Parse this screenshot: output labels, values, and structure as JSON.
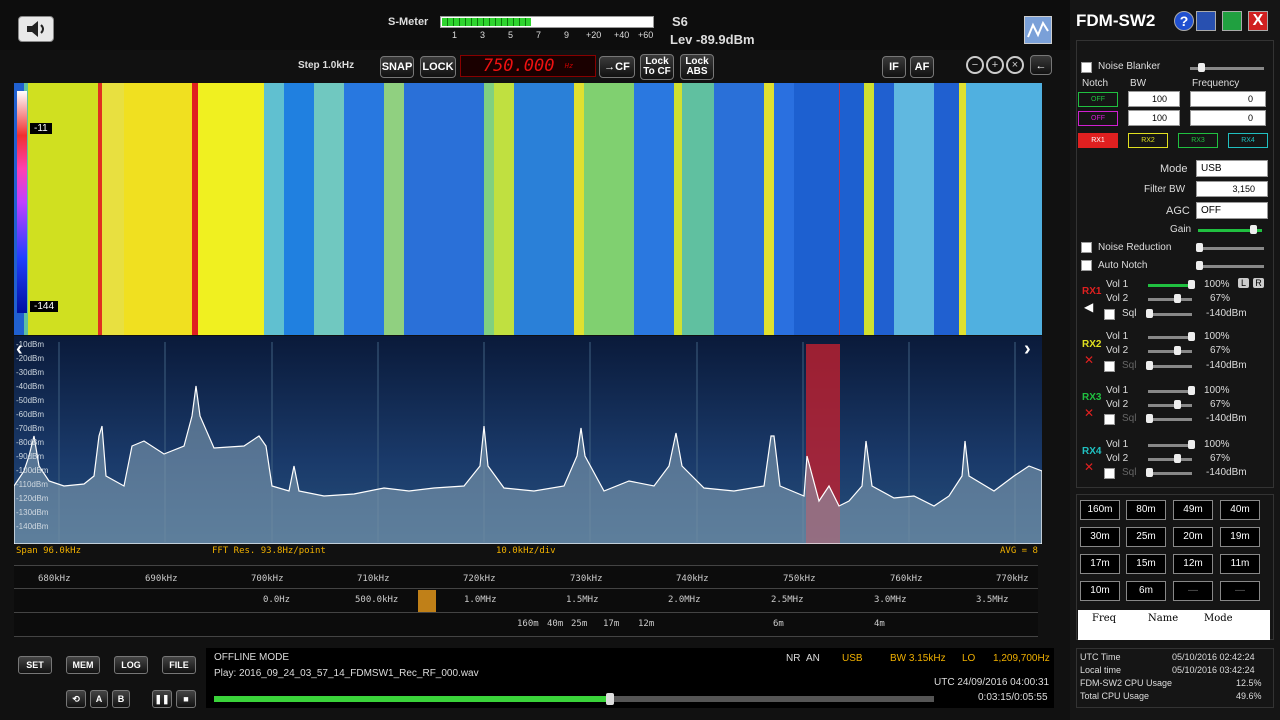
{
  "app": {
    "title": "FDM-SW2",
    "help": "?"
  },
  "smeter": {
    "label": "S-Meter",
    "ticks": [
      "1",
      "3",
      "5",
      "7",
      "9",
      "+20",
      "+40",
      "+60"
    ],
    "s_value": "S6",
    "level": "Lev -89.9dBm",
    "fill_fraction": 0.42
  },
  "controls": {
    "step": "Step 1.0kHz",
    "snap": "SNAP",
    "lock": "LOCK",
    "frequency": "750.000",
    "freq_unit": "Hz",
    "to_cf": "→CF",
    "lock_to_cf_1": "Lock",
    "lock_to_cf_2": "To CF",
    "lock_abs_1": "Lock",
    "lock_abs_2": "ABS",
    "if": "IF",
    "af": "AF"
  },
  "waterfall": {
    "top_label": "-11",
    "bottom_label": "-144"
  },
  "spectrum": {
    "db_labels": [
      "-10dBm",
      "-20dBm",
      "-30dBm",
      "-40dBm",
      "-50dBm",
      "-60dBm",
      "-70dBm",
      "-80dBm",
      "-90dBm",
      "-100dBm",
      "-110dBm",
      "-120dBm",
      "-130dBm",
      "-140dBm"
    ],
    "span": "Span 96.0kHz",
    "fft": "FFT Res. 93.8Hz/point",
    "div": "10.0kHz/div",
    "avg": "AVG = 8"
  },
  "freqscale": {
    "row1": [
      "680kHz",
      "690kHz",
      "700kHz",
      "710kHz",
      "720kHz",
      "730kHz",
      "740kHz",
      "750kHz",
      "760kHz",
      "770kHz"
    ],
    "row2": [
      "0.0Hz",
      "500.0kHz",
      "1.0MHz",
      "1.5MHz",
      "2.0MHz",
      "2.5MHz",
      "3.0MHz",
      "3.5MHz"
    ],
    "row3": [
      "160m",
      "40m",
      "25m",
      "17m",
      "12m",
      "6m",
      "4m"
    ]
  },
  "bottom_buttons": {
    "set": "SET",
    "mem": "MEM",
    "log": "LOG",
    "file": "FILE",
    "a": "A",
    "b": "B"
  },
  "status": {
    "mode": "OFFLINE MODE",
    "play": "Play: 2016_09_24_03_57_14_FDMSW1_Rec_RF_000.wav",
    "nr": "NR",
    "an": "AN",
    "demod": "USB",
    "bw": "BW 3.15kHz",
    "lo": "LO",
    "lo_freq": "1,209,700Hz",
    "utc": "UTC 24/09/2016 04:00:31",
    "time": "0:03:15/0:05:55",
    "progress_fraction": 0.55
  },
  "right": {
    "noise_blanker": "Noise Blanker",
    "notch": "Notch",
    "bw": "BW",
    "frequency": "Frequency",
    "notch_rows": [
      {
        "state": "OFF",
        "bw": "100",
        "freq": "0"
      },
      {
        "state": "OFF",
        "bw": "100",
        "freq": "0"
      }
    ],
    "rx_tabs": [
      "RX1",
      "RX2",
      "RX3",
      "RX4"
    ],
    "mode_label": "Mode",
    "mode": "USB",
    "filter_bw_label": "Filter BW",
    "filter_bw": "3,150",
    "agc_label": "AGC",
    "agc": "OFF",
    "gain_label": "Gain",
    "noise_reduction": "Noise Reduction",
    "auto_notch": "Auto Notch",
    "rx": [
      {
        "name": "RX1",
        "vol1": "Vol 1",
        "vol1v": "100%",
        "vol2": "Vol 2",
        "vol2v": "67%",
        "sql": "Sql",
        "sqlv": "-140dBm",
        "lr_l": "L",
        "lr_r": "R"
      },
      {
        "name": "RX2",
        "vol1": "Vol 1",
        "vol1v": "100%",
        "vol2": "Vol 2",
        "vol2v": "67%",
        "sql": "Sql",
        "sqlv": "-140dBm"
      },
      {
        "name": "RX3",
        "vol1": "Vol 1",
        "vol1v": "100%",
        "vol2": "Vol 2",
        "vol2v": "67%",
        "sql": "Sql",
        "sqlv": "-140dBm"
      },
      {
        "name": "RX4",
        "vol1": "Vol 1",
        "vol1v": "100%",
        "vol2": "Vol 2",
        "vol2v": "67%",
        "sql": "Sql",
        "sqlv": "-140dBm"
      }
    ],
    "bands": [
      "160m",
      "80m",
      "49m",
      "40m",
      "30m",
      "25m",
      "20m",
      "19m",
      "17m",
      "15m",
      "12m",
      "11m",
      "10m",
      "6m",
      "—",
      "—"
    ],
    "mem_cols": [
      "Freq",
      "Name",
      "Mode"
    ],
    "info": [
      {
        "k": "UTC Time",
        "v": "05/10/2016 02:42:24"
      },
      {
        "k": "Local time",
        "v": "05/10/2016 03:42:24"
      },
      {
        "k": "FDM-SW2 CPU Usage",
        "v": "12.5%"
      },
      {
        "k": "Total CPU Usage",
        "v": "49.6%"
      }
    ]
  },
  "colors": {
    "accent": "#e01010",
    "meter": "#2fd42f",
    "rx1": "#e02020",
    "rx2": "#e0e020",
    "rx3": "#20c040",
    "rx4": "#20c0c0"
  }
}
